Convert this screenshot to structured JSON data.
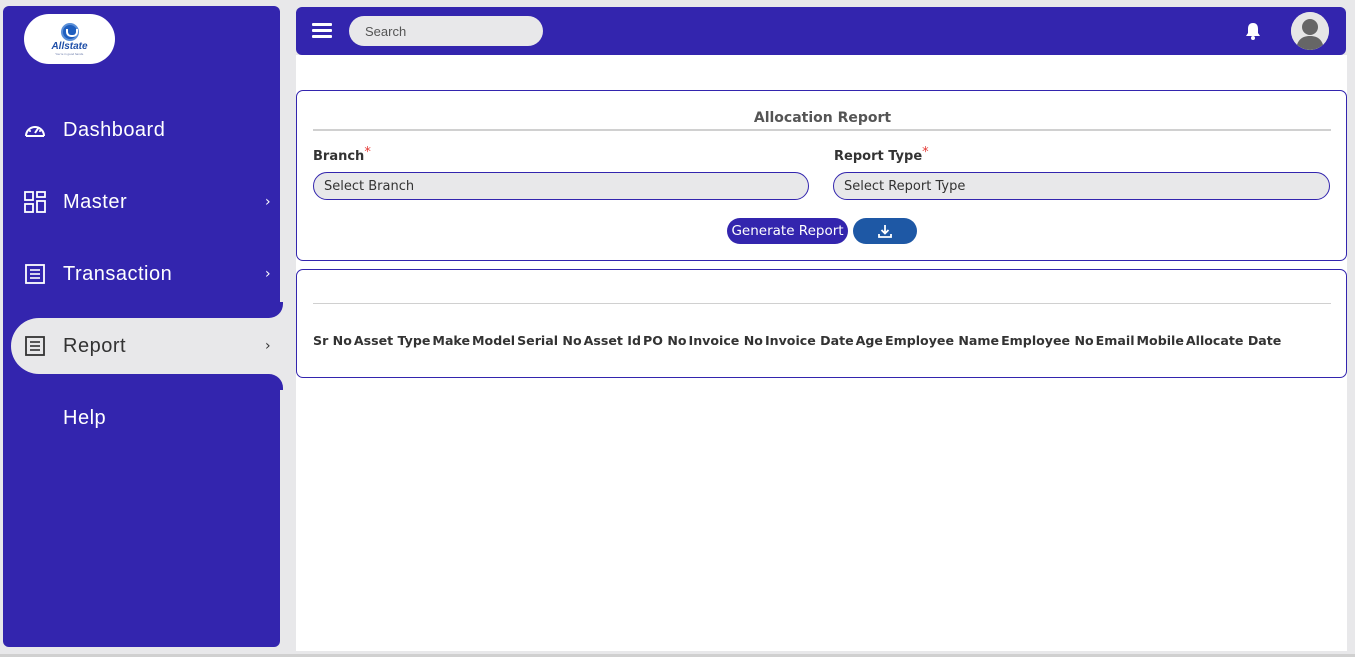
{
  "brand": {
    "logo_text": "Allstate",
    "logo_sub": "You're in good hands."
  },
  "sidebar": {
    "items": [
      {
        "label": "Dashboard",
        "icon": "dashboard-gauge-icon",
        "has_chevron": false
      },
      {
        "label": "Master",
        "icon": "grid-icon",
        "has_chevron": true
      },
      {
        "label": "Transaction",
        "icon": "document-list-icon",
        "has_chevron": true
      },
      {
        "label": "Report",
        "icon": "document-list-icon",
        "has_chevron": true,
        "active": true
      },
      {
        "label": "Help",
        "icon": "",
        "has_chevron": false
      }
    ],
    "chevron": "›"
  },
  "topbar": {
    "search_placeholder": "Search",
    "icons": [
      "menu-icon",
      "bell-icon",
      "user-avatar-icon"
    ]
  },
  "report_form": {
    "title": "Allocation Report",
    "branch_label": "Branch",
    "branch_placeholder": "Select Branch",
    "report_type_label": "Report Type",
    "report_type_placeholder": "Select Report Type",
    "required_mark": "*",
    "generate_label": "Generate Report"
  },
  "table": {
    "headers": [
      "Sr No",
      "Asset Type",
      "Make",
      "Model",
      "Serial No",
      "Asset Id",
      "PO No",
      "Invoice No",
      "Invoice Date",
      "Age",
      "Employee Name",
      "Employee No",
      "Email",
      "Mobile",
      "Allocate Date"
    ]
  },
  "colors": {
    "primary": "#3325ae",
    "download_button": "#1e58a5",
    "background": "#e8e8ea",
    "required": "#e53935"
  }
}
